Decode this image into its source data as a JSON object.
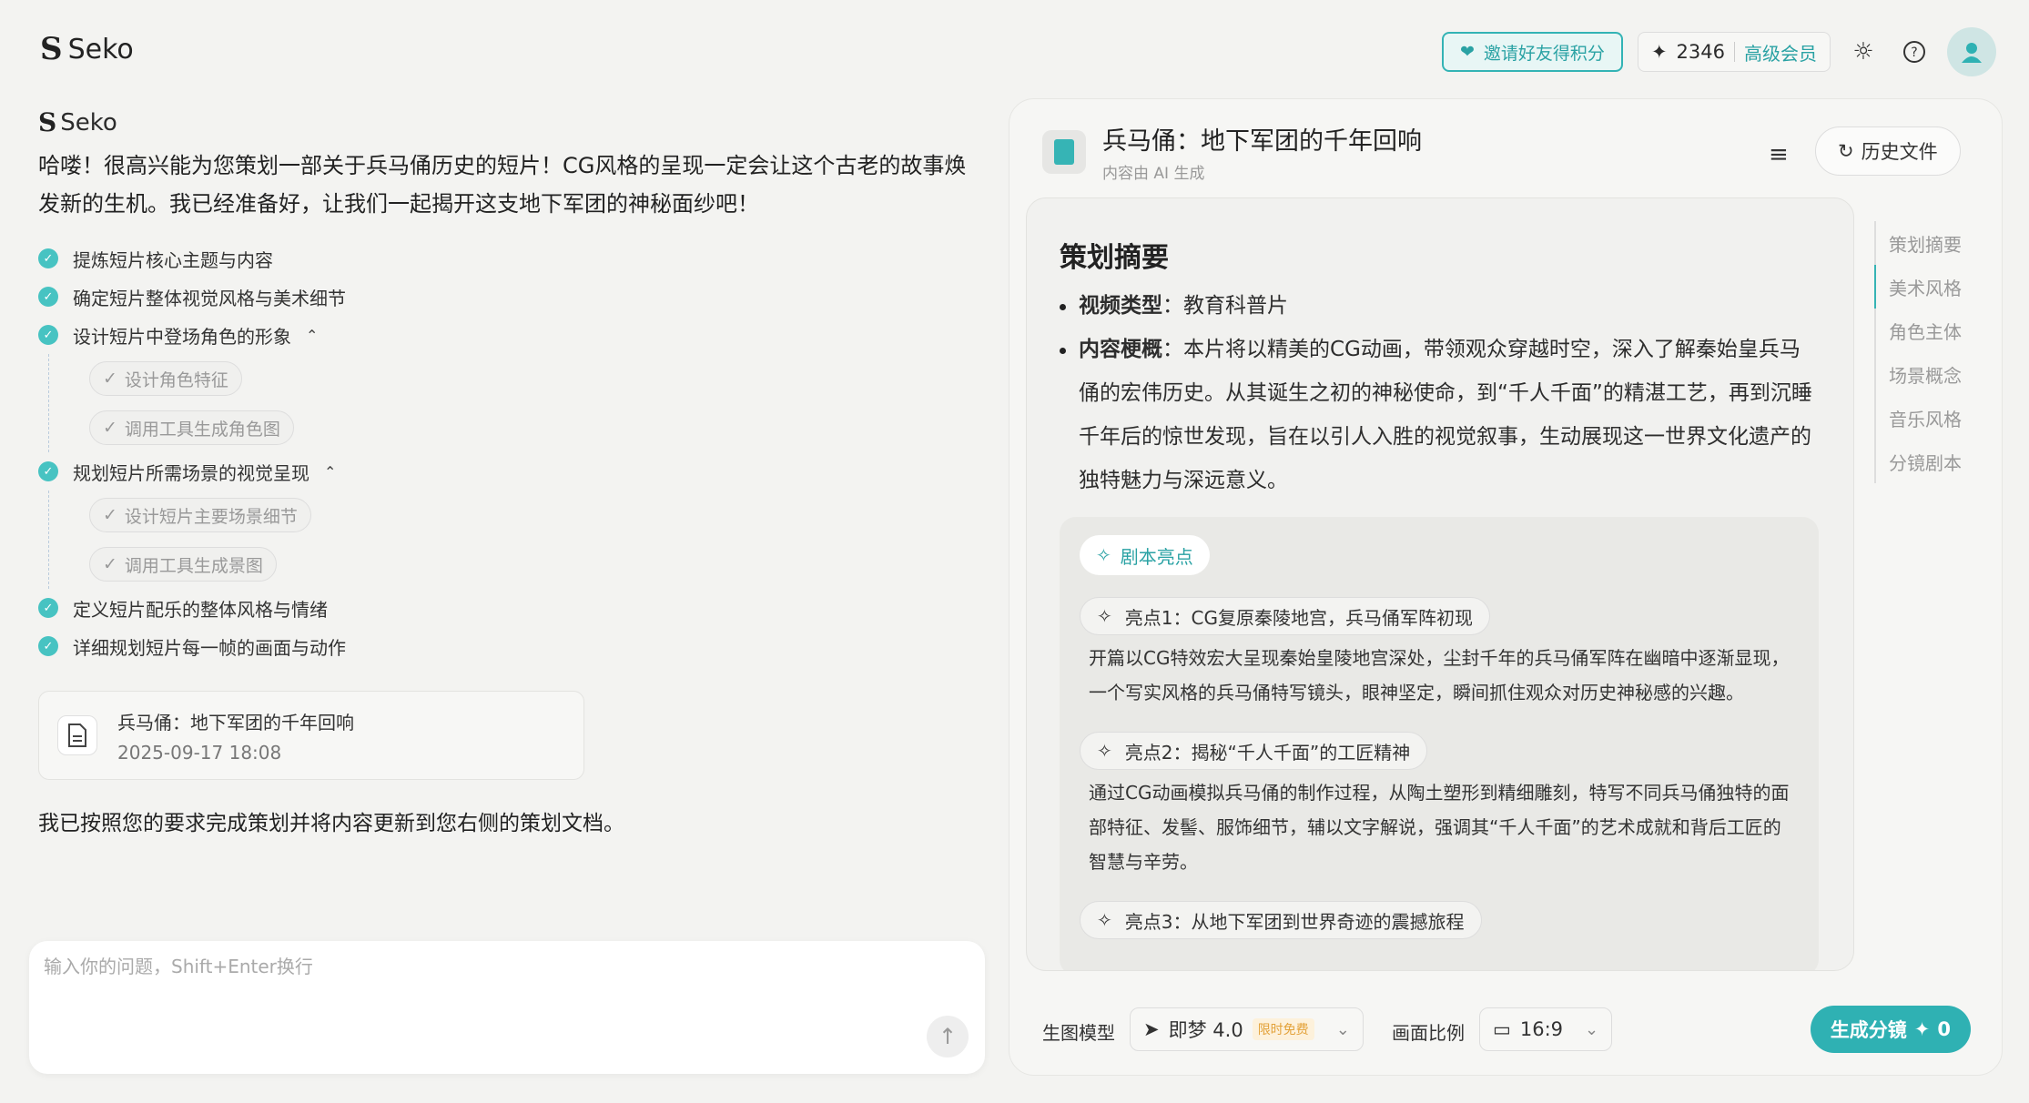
{
  "header": {
    "brand": "Seko",
    "invite_label": "邀请好友得积分",
    "points": "2346",
    "member_label": "高级会员"
  },
  "chat": {
    "bot_name": "Seko",
    "intro": "哈喽！很高兴能为您策划一部关于兵马俑历史的短片！CG风格的呈现一定会让这个古老的故事焕发新的生机。我已经准备好，让我们一起揭开这支地下军团的神秘面纱吧！",
    "steps": {
      "s1": "提炼短片核心主题与内容",
      "s2": "确定短片整体视觉风格与美术细节",
      "s3": "设计短片中登场角色的形象",
      "s3a": "设计角色特征",
      "s3b": "调用工具生成角色图",
      "s4": "规划短片所需场景的视觉呈现",
      "s4a": "设计短片主要场景细节",
      "s4b": "调用工具生成景图",
      "s5": "定义短片配乐的整体风格与情绪",
      "s6": "详细规划短片每一帧的画面与动作"
    },
    "doc_card": {
      "title": "兵马俑：地下军团的千年回响",
      "time": "2025-09-17 18:08"
    },
    "done_text": "我已按照您的要求完成策划并将内容更新到您右侧的策划文档。",
    "input_placeholder": "输入你的问题，Shift+Enter换行"
  },
  "panel": {
    "title": "兵马俑：地下军团的千年回响",
    "subtitle": "内容由 AI 生成",
    "history_label": "历史文件",
    "summary_heading": "策划摘要",
    "video_type_label": "视频类型",
    "video_type_value": "：教育科普片",
    "content_label": "内容梗概",
    "content_value": "：本片将以精美的CG动画，带领观众穿越时空，深入了解秦始皇兵马俑的宏伟历史。从其诞生之初的神秘使命，到“千人千面”的精湛工艺，再到沉睡千年后的惊世发现，旨在以引人入胜的视觉叙事，生动展现这一世界文化遗产的独特魅力与深远意义。",
    "highlight_tag": "剧本亮点",
    "point1_title": "亮点1：CG复原秦陵地宫，兵马俑军阵初现",
    "point1_text": "开篇以CG特效宏大呈现秦始皇陵地宫深处，尘封千年的兵马俑军阵在幽暗中逐渐显现，一个写实风格的兵马俑特写镜头，眼神坚定，瞬间抓住观众对历史神秘感的兴趣。",
    "point2_title": "亮点2：揭秘“千人千面”的工匠精神",
    "point2_text": "通过CG动画模拟兵马俑的制作过程，从陶土塑形到精细雕刻，特写不同兵马俑独特的面部特征、发髻、服饰细节，辅以文字解说，强调其“千人千面”的艺术成就和背后工匠的智慧与辛劳。",
    "point3_title": "亮点3：从地下军团到世界奇迹的震撼旅程",
    "toc": [
      "策划摘要",
      "美术风格",
      "角色主体",
      "场景概念",
      "音乐风格",
      "分镜剧本"
    ],
    "toc_active_index": 1,
    "model_label": "生图模型",
    "model_value": "即梦 4.0",
    "model_badge": "限时免费",
    "ratio_label": "画面比例",
    "ratio_value": "16:9",
    "generate_label": "生成分镜",
    "generate_cost": "0"
  },
  "colors": {
    "accent": "#2fb1b3",
    "background": "#f3f3f1"
  }
}
